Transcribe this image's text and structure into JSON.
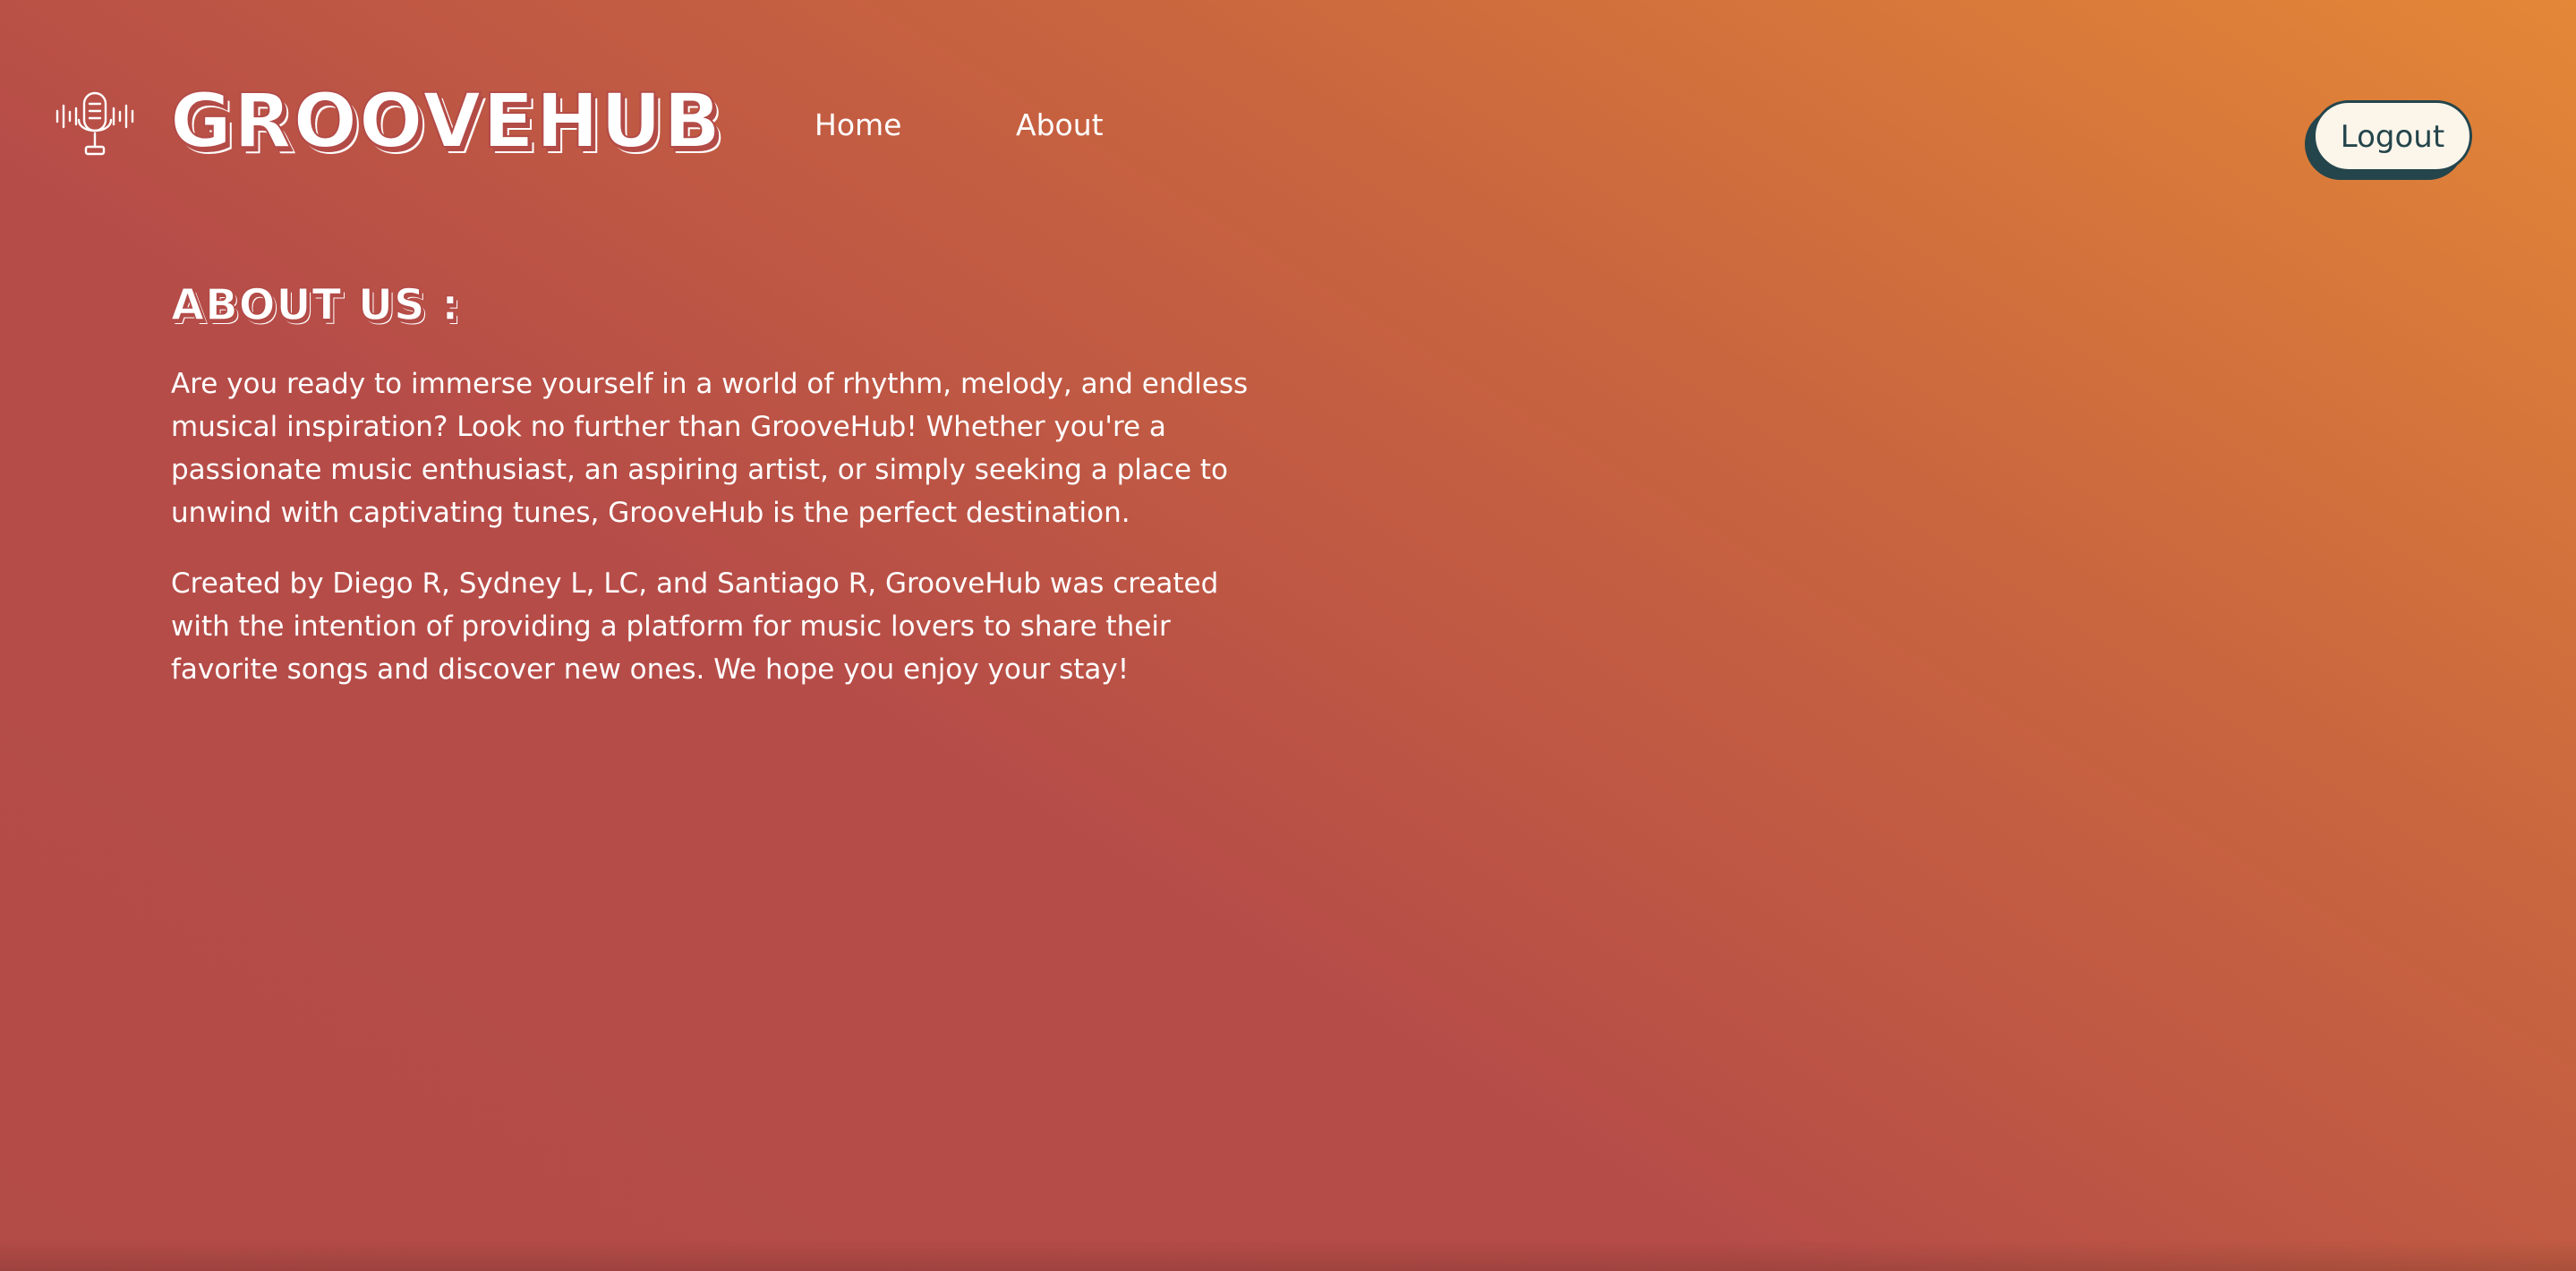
{
  "header": {
    "logo_icon": "microphone-soundwave-icon",
    "brand": "GROOVEHUB",
    "nav": [
      {
        "label": "Home"
      },
      {
        "label": "About"
      }
    ],
    "logout_label": "Logout"
  },
  "main": {
    "title": "ABOUT US :",
    "paragraphs": [
      "Are you ready to immerse yourself in a world of rhythm, melody, and endless musical inspiration? Look no further than GrooveHub! Whether you're a passionate music enthusiast, an aspiring artist, or simply seeking a place to unwind with captivating tunes, GrooveHub is the perfect destination.",
      "Created by Diego R, Sydney L, LC, and Santiago R, GrooveHub was created with the intention of providing a platform for music lovers to share their favorite songs and discover new ones. We hope you enjoy your stay!"
    ]
  },
  "colors": {
    "gradient_start": "#b34b47",
    "gradient_end": "#e48737",
    "button_bg": "#fbf5ea",
    "button_text": "#24454c"
  }
}
